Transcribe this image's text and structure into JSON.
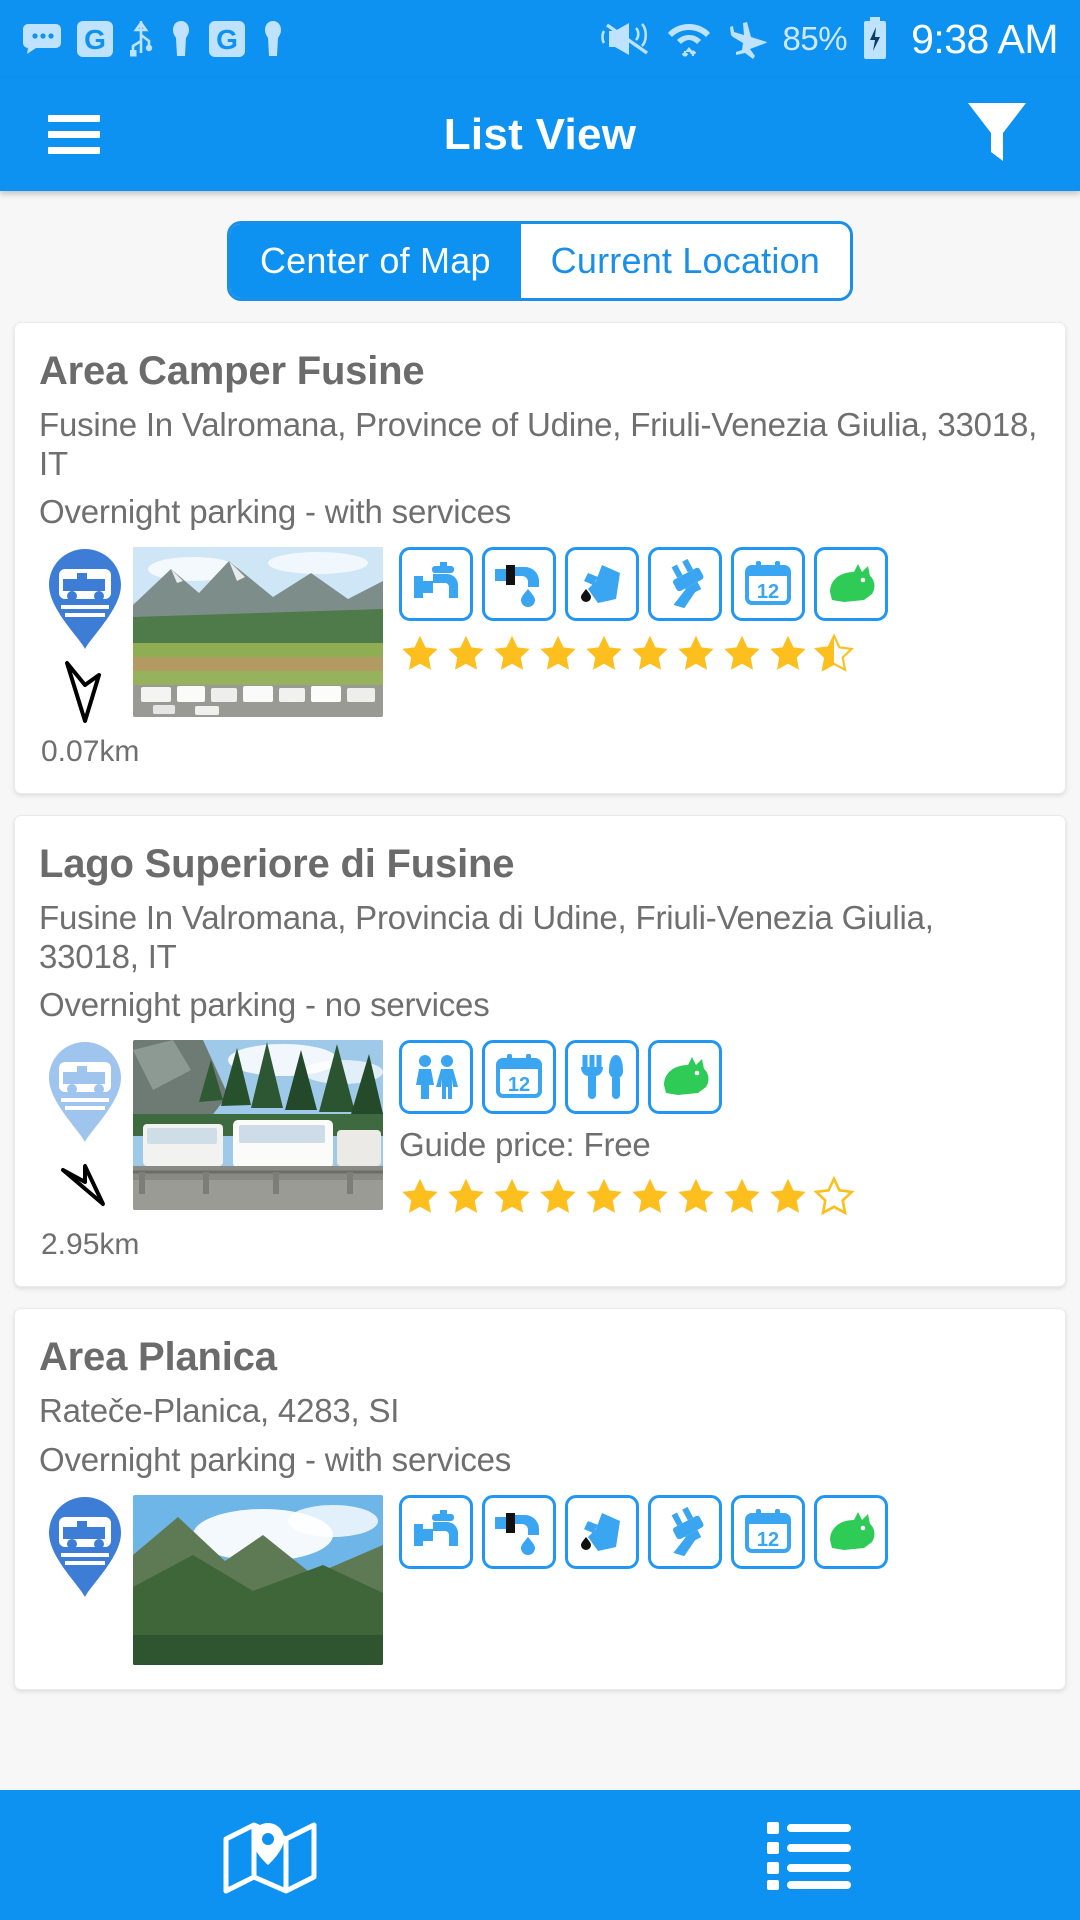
{
  "status_bar": {
    "icons": [
      "message-icon",
      "google-g-icon",
      "usb-icon",
      "key-icon",
      "google-g-icon",
      "key-icon",
      "vibrate-off-icon",
      "wifi-icon",
      "airplane-mode-icon"
    ],
    "battery_percent": "85%",
    "battery_icon": "battery-charging-icon",
    "time": "9:38 AM"
  },
  "app_bar": {
    "menu_icon": "hamburger-menu-icon",
    "title": "List View",
    "filter_icon": "filter-icon"
  },
  "toggle": {
    "options": [
      {
        "label": "Center of Map",
        "active": true
      },
      {
        "label": "Current Location",
        "active": false
      }
    ]
  },
  "colors": {
    "accent_blue": "#0d92f2",
    "icon_blue": "#2196f3",
    "star_gold": "#fcbf1e",
    "dog_green": "#2ecc57",
    "text_grey": "#6f6f6f"
  },
  "cards": [
    {
      "title": "Area Camper Fusine",
      "address": "Fusine In Valromana, Province of Udine, Friuli-Venezia Giulia, 33018, IT",
      "type": "Overnight parking - with services",
      "distance": "0.07km",
      "marker_icon": "camper-map-pin-icon",
      "marker_style": "solid",
      "bearing_icon": "direction-arrow-icon",
      "thumb_alt": "campsite-photo-mountains-meadow",
      "amenities": [
        "fresh-water-tap-icon",
        "waste-water-drain-icon",
        "grey-water-icon",
        "electric-hookup-icon",
        "calendar-12-icon",
        "dog-allowed-icon"
      ],
      "price": null,
      "rating_full": 9,
      "rating_half": true,
      "rating_empty": 0,
      "rating_total": 10
    },
    {
      "title": "Lago Superiore di Fusine",
      "address": "Fusine In Valromana, Provincia di Udine, Friuli-Venezia Giulia, 33018, IT",
      "type": "Overnight parking - no services",
      "distance": "2.95km",
      "marker_icon": "camper-map-pin-icon",
      "marker_style": "faded",
      "bearing_icon": "direction-arrow-icon",
      "thumb_alt": "campsite-photo-forest-campers",
      "amenities": [
        "toilets-icon",
        "calendar-12-icon",
        "restaurant-icon",
        "dog-allowed-icon"
      ],
      "price": "Guide price: Free",
      "rating_full": 9,
      "rating_half": false,
      "rating_empty": 1,
      "rating_total": 10
    },
    {
      "title": "Area Planica",
      "address": "Rateče-Planica, 4283, SI",
      "type": "Overnight parking - with services",
      "distance": "",
      "marker_icon": "camper-map-pin-icon",
      "marker_style": "solid",
      "bearing_icon": "direction-arrow-icon",
      "thumb_alt": "campsite-photo-mountain-sky",
      "amenities": [
        "fresh-water-tap-icon",
        "waste-water-drain-icon",
        "grey-water-icon",
        "electric-hookup-icon",
        "calendar-12-icon",
        "dog-allowed-icon"
      ],
      "price": null,
      "rating_full": 0,
      "rating_half": false,
      "rating_empty": 0,
      "rating_total": 0
    }
  ],
  "bottom_nav": {
    "items": [
      {
        "icon": "map-view-icon",
        "active": false
      },
      {
        "icon": "list-view-icon",
        "active": true
      }
    ]
  }
}
